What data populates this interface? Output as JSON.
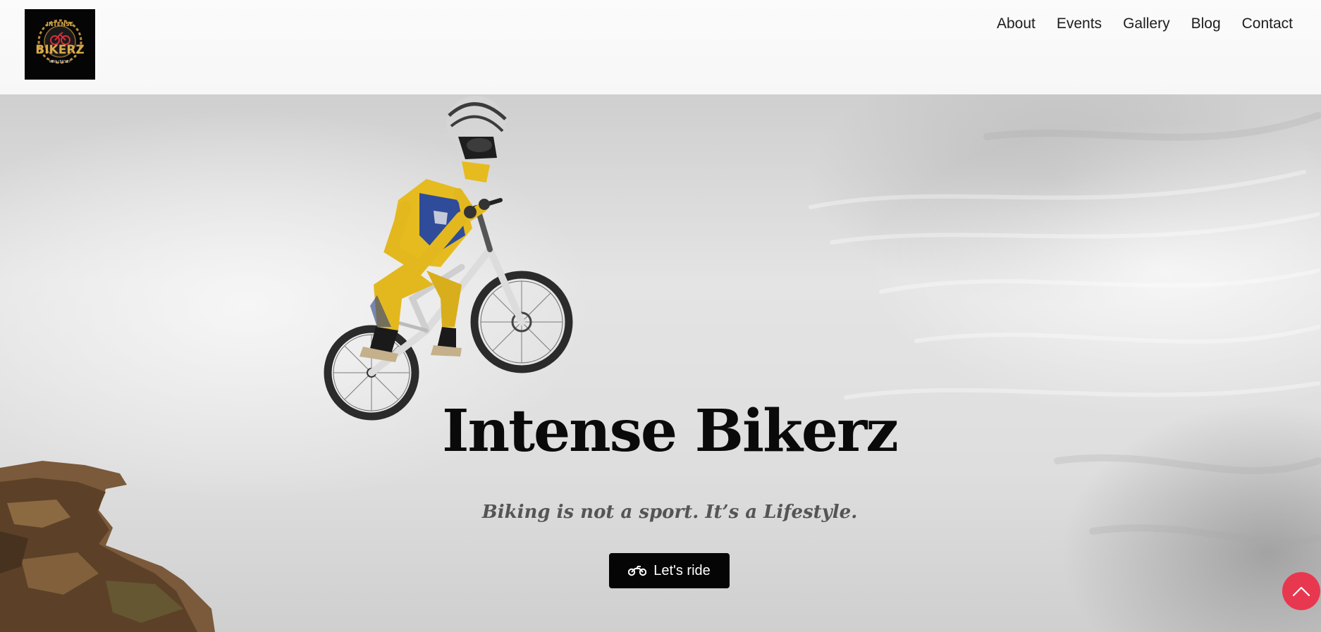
{
  "brand": {
    "logo_text_top": "INTENSE",
    "logo_text_main": "BIKERZ",
    "logo_text_bottom": "NEW JERSEY"
  },
  "nav": {
    "items": [
      {
        "label": "About"
      },
      {
        "label": "Events"
      },
      {
        "label": "Gallery"
      },
      {
        "label": "Blog"
      },
      {
        "label": "Contact"
      }
    ]
  },
  "hero": {
    "title": "Intense Bikerz",
    "tagline": "Biking is not a sport. It’s a Lifestyle.",
    "cta_label": "Let's ride",
    "cta_icon": "motorcycle-icon"
  },
  "scroll_top": {
    "icon": "chevron-up-icon",
    "color": "#e8384f"
  },
  "colors": {
    "accent": "#e8384f",
    "button_bg": "#050505",
    "logo_gold": "#d9a94a"
  }
}
